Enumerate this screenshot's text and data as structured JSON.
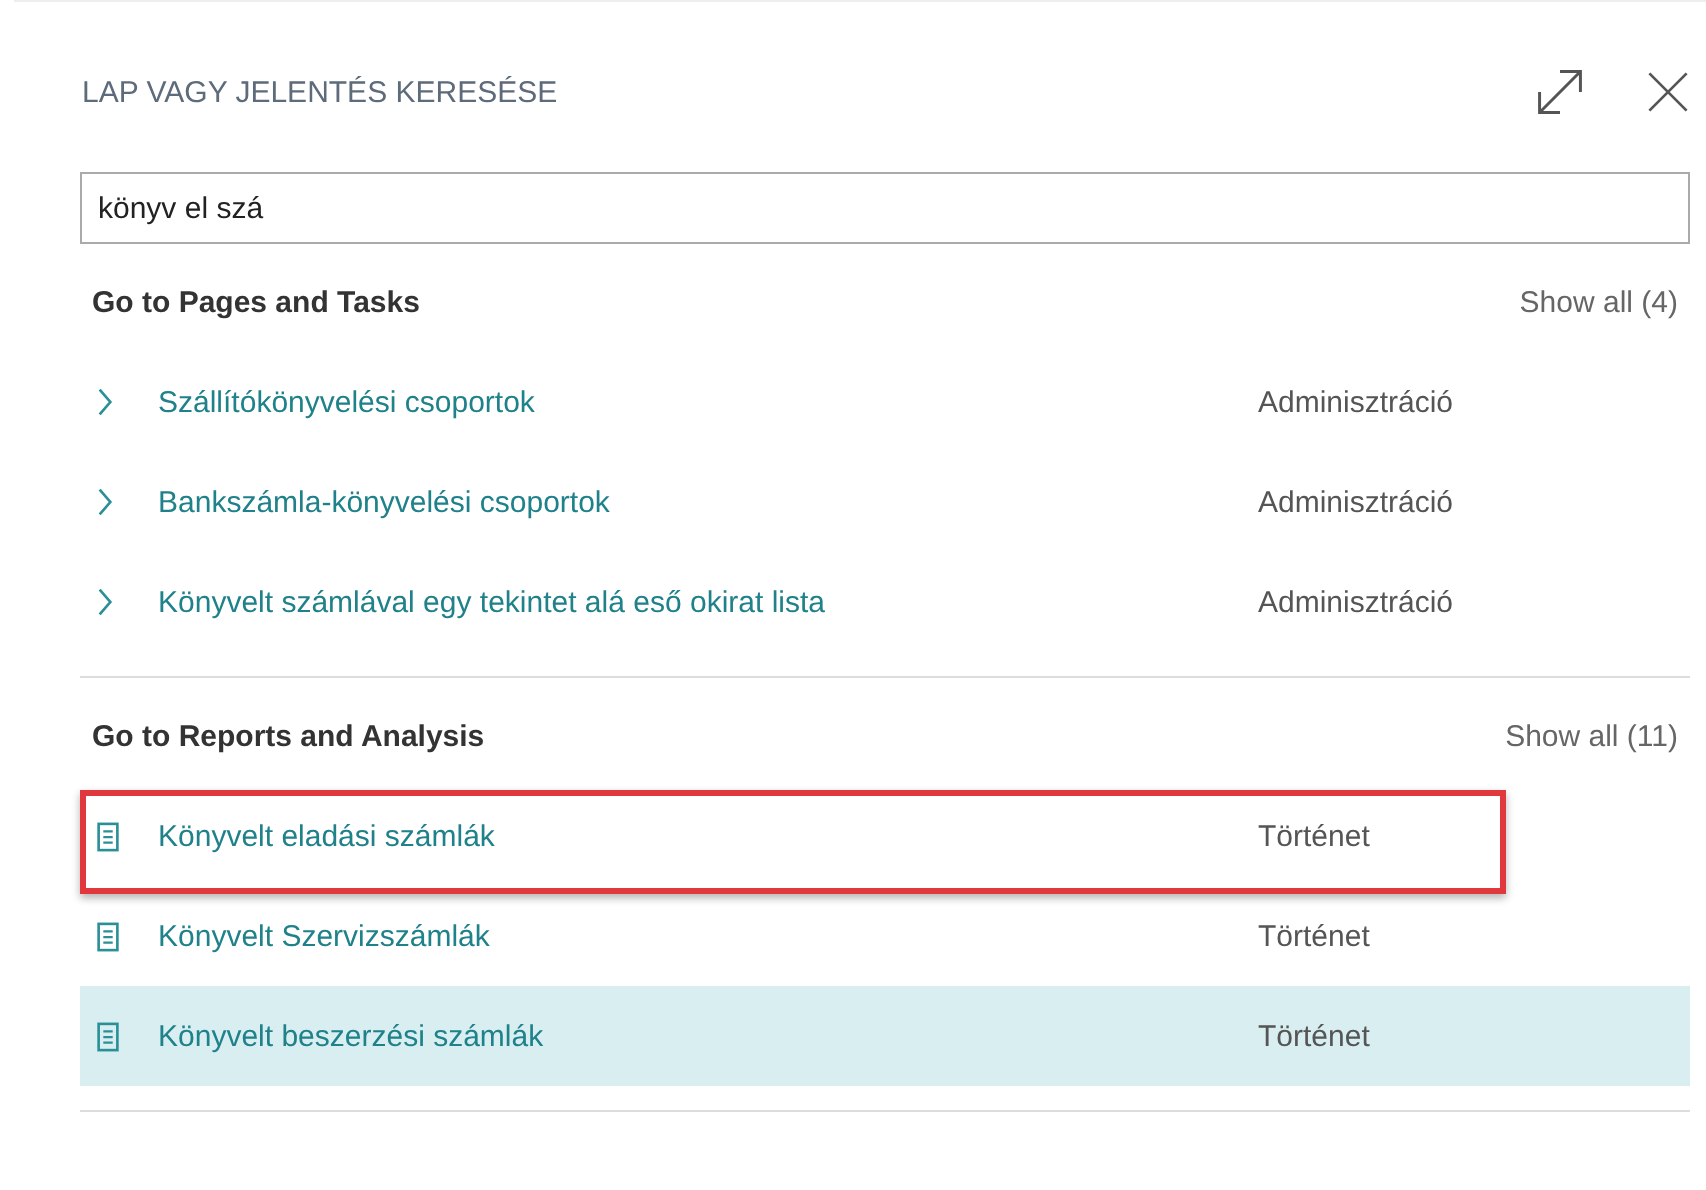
{
  "panel": {
    "title": "LAP VAGY JELENTÉS KERESÉSE"
  },
  "search": {
    "value": "könyv el szá"
  },
  "sections": [
    {
      "heading": "Go to Pages and Tasks",
      "show_all": "Show all (4)",
      "items": [
        {
          "kind": "page",
          "name": "Szállítókönyvelési csoportok",
          "category": "Adminisztráció",
          "selected": false,
          "highlighted": false
        },
        {
          "kind": "page",
          "name": "Bankszámla-könyvelési csoportok",
          "category": "Adminisztráció",
          "selected": false,
          "highlighted": false
        },
        {
          "kind": "page",
          "name": "Könyvelt számlával egy tekintet alá eső okirat lista",
          "category": "Adminisztráció",
          "selected": false,
          "highlighted": false
        }
      ]
    },
    {
      "heading": "Go to Reports and Analysis",
      "show_all": "Show all (11)",
      "items": [
        {
          "kind": "report",
          "name": "Könyvelt eladási számlák",
          "category": "Történet",
          "selected": false,
          "highlighted": true
        },
        {
          "kind": "report",
          "name": "Könyvelt Szervizszámlák",
          "category": "Történet",
          "selected": false,
          "highlighted": false
        },
        {
          "kind": "report",
          "name": "Könyvelt beszerzési számlák",
          "category": "Történet",
          "selected": true,
          "highlighted": false
        }
      ]
    }
  ]
}
